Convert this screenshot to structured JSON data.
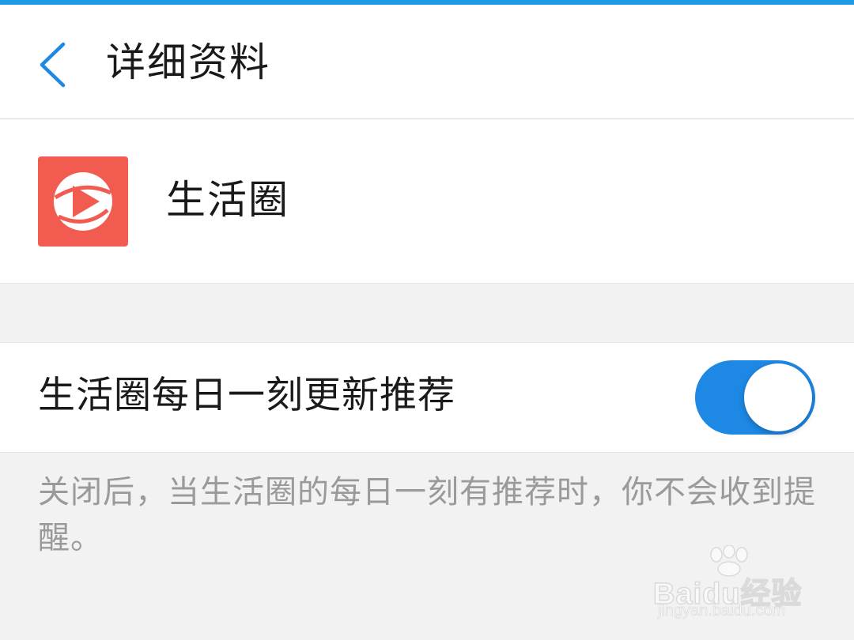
{
  "header": {
    "title": "详细资料",
    "back_icon": "chevron-left-icon",
    "accent_color": "#1e9be6"
  },
  "profile": {
    "app_name": "生活圈",
    "logo_icon": "play-ball-logo",
    "logo_color": "#f25b50"
  },
  "setting": {
    "label": "生活圈每日一刻更新推荐",
    "toggle_state": "on",
    "toggle_color": "#1e88e5",
    "note": "关闭后，当生活圈的每日一刻有推荐时，你不会收到提醒。"
  },
  "watermark": {
    "brand": "Baidu经验",
    "url": "jingyan.baidu.com"
  }
}
